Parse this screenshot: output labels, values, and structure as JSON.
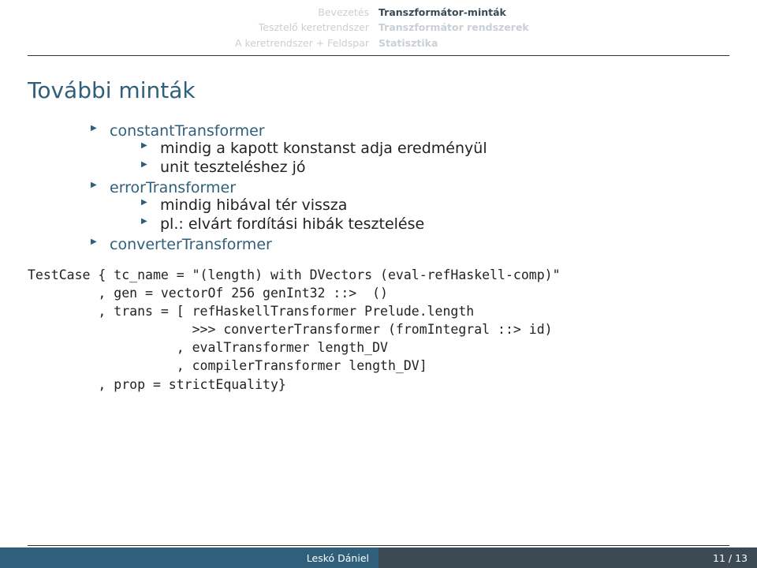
{
  "nav": {
    "left": [
      "Bevezetés",
      "Tesztelő keretrendszer",
      "A keretrendszer + Feldspar"
    ],
    "right": [
      "Transzformátor-minták",
      "Transzformátor rendszerek",
      "Statisztika"
    ],
    "activeRight": 0
  },
  "title": "További minták",
  "bullets": [
    {
      "label": "constantTransformer",
      "sub": [
        {
          "text": "mindig a kapott konstanst adja eredményül"
        },
        {
          "text": "unit teszteléshez jó"
        }
      ]
    },
    {
      "label": "errorTransformer",
      "sub": [
        {
          "text": "mindig hibával tér vissza"
        },
        {
          "text": "pl.: elvárt fordítási hibák tesztelése"
        }
      ]
    },
    {
      "label": "converterTransformer",
      "sub": []
    }
  ],
  "code": "TestCase { tc_name = \"(length) with DVectors (eval-refHaskell-comp)\"\n         , gen = vectorOf 256 genInt32 ::>  ()\n         , trans = [ refHaskellTransformer Prelude.length\n                     >>> converterTransformer (fromIntegral ::> id)\n                   , evalTransformer length_DV\n                   , compilerTransformer length_DV]\n         , prop = strictEquality}",
  "footer": {
    "author": "Leskó Dániel",
    "page": "11 / 13"
  }
}
